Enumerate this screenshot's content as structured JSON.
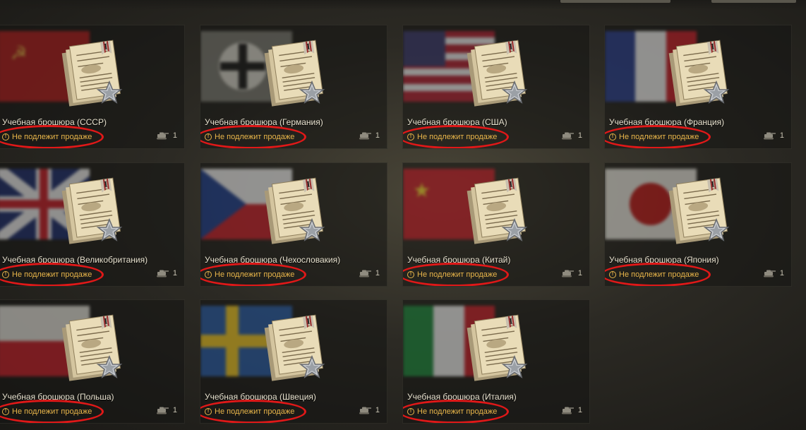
{
  "colors": {
    "status": "#e8b54a",
    "highlight_ring": "#e01818",
    "title": "#e8e2cf"
  },
  "items": [
    {
      "title": "Учебная брошюра (СССР)",
      "status": "Не подлежит продаже",
      "count": "1",
      "flag": "ussr",
      "status_icon": "warning-circle-icon",
      "count_icon": "tank-icon"
    },
    {
      "title": "Учебная брошюра (Германия)",
      "status": "Не подлежит продаже",
      "count": "1",
      "flag": "germany",
      "status_icon": "warning-circle-icon",
      "count_icon": "tank-icon"
    },
    {
      "title": "Учебная брошюра (США)",
      "status": "Не подлежит продаже",
      "count": "1",
      "flag": "usa",
      "status_icon": "warning-circle-icon",
      "count_icon": "tank-icon"
    },
    {
      "title": "Учебная брошюра (Франция)",
      "status": "Не подлежит продаже",
      "count": "1",
      "flag": "france",
      "status_icon": "warning-circle-icon",
      "count_icon": "tank-icon"
    },
    {
      "title": "Учебная брошюра (Великобритания)",
      "status": "Не подлежит продаже",
      "count": "1",
      "flag": "uk",
      "status_icon": "warning-circle-icon",
      "count_icon": "tank-icon"
    },
    {
      "title": "Учебная брошюра (Чехословакия)",
      "status": "Не подлежит продаже",
      "count": "1",
      "flag": "czech",
      "status_icon": "warning-circle-icon",
      "count_icon": "tank-icon"
    },
    {
      "title": "Учебная брошюра (Китай)",
      "status": "Не подлежит продаже",
      "count": "1",
      "flag": "china",
      "status_icon": "warning-circle-icon",
      "count_icon": "tank-icon"
    },
    {
      "title": "Учебная брошюра (Япония)",
      "status": "Не подлежит продаже",
      "count": "1",
      "flag": "japan",
      "status_icon": "warning-circle-icon",
      "count_icon": "tank-icon"
    },
    {
      "title": "Учебная брошюра (Польша)",
      "status": "Не подлежит продаже",
      "count": "1",
      "flag": "poland",
      "status_icon": "warning-circle-icon",
      "count_icon": "tank-icon"
    },
    {
      "title": "Учебная брошюра (Швеция)",
      "status": "Не подлежит продаже",
      "count": "1",
      "flag": "sweden",
      "status_icon": "warning-circle-icon",
      "count_icon": "tank-icon"
    },
    {
      "title": "Учебная брошюра (Италия)",
      "status": "Не подлежит продаже",
      "count": "1",
      "flag": "italy",
      "status_icon": "warning-circle-icon",
      "count_icon": "tank-icon"
    }
  ]
}
